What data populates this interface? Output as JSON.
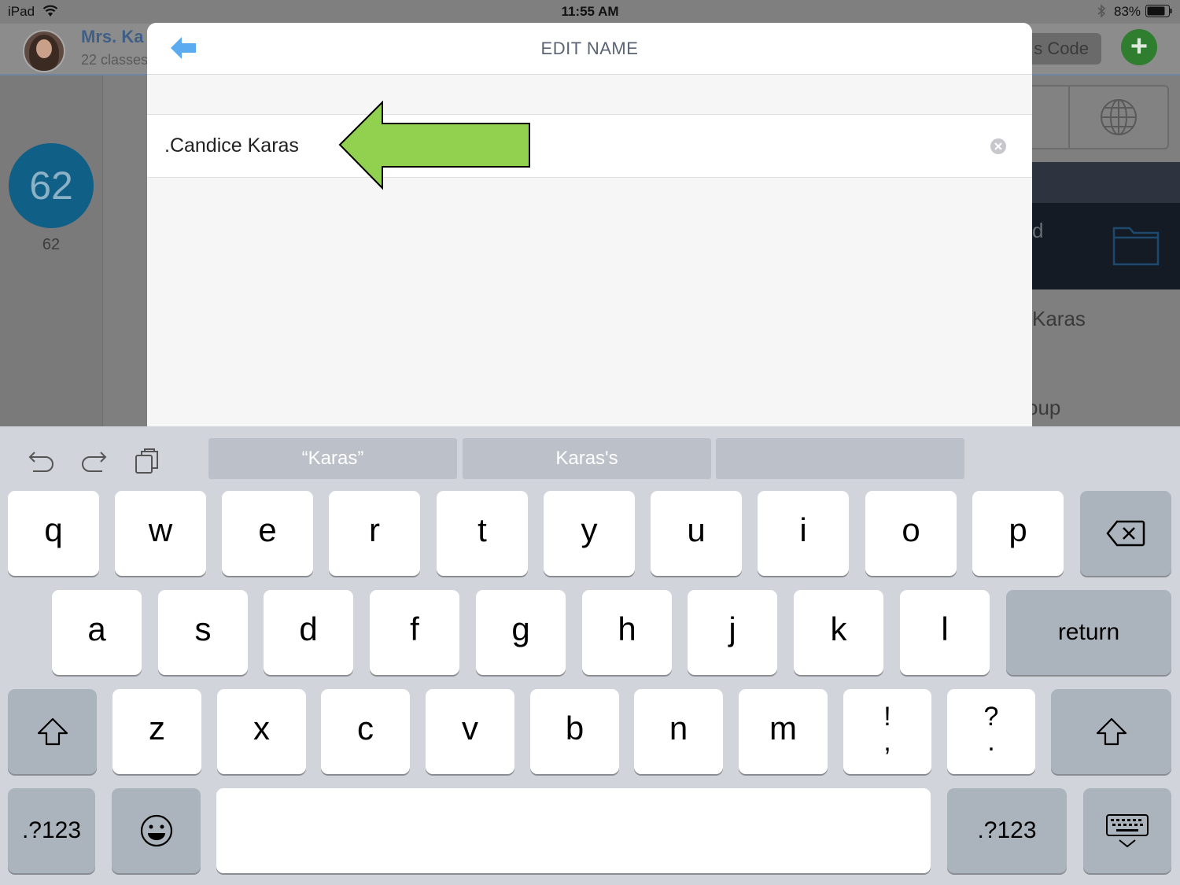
{
  "status_bar": {
    "device": "iPad",
    "time": "11:55 AM",
    "battery": "83%",
    "icons": [
      "wifi-icon",
      "bluetooth-icon",
      "battery-icon"
    ]
  },
  "background": {
    "teacher_name": "Mrs. Ka",
    "classes_count": "22 classes",
    "code_button": "s Code",
    "add_button": "+",
    "score_value": "62",
    "score_label": "62",
    "dark_row_text": "d",
    "name_row_text": "Karas",
    "group_row_text": "oup",
    "icons": [
      "globe-icon",
      "folder-icon",
      "add-icon"
    ]
  },
  "modal": {
    "title": "EDIT NAME",
    "name_value": ".Candice Karas",
    "icons": [
      "back-arrow-icon",
      "clear-icon",
      "green-arrow-annotation"
    ]
  },
  "keyboard": {
    "suggestions": [
      "“Karas”",
      "Karas's",
      ""
    ],
    "row1": [
      "q",
      "w",
      "e",
      "r",
      "t",
      "y",
      "u",
      "i",
      "o",
      "p"
    ],
    "row2": [
      "a",
      "s",
      "d",
      "f",
      "g",
      "h",
      "j",
      "k",
      "l"
    ],
    "row3": [
      "z",
      "x",
      "c",
      "v",
      "b",
      "n",
      "m"
    ],
    "punct1": {
      "top": "!",
      "bottom": ","
    },
    "punct2": {
      "top": "?",
      "bottom": "."
    },
    "return_label": "return",
    "numbers_label": ".?123",
    "space_label": "",
    "icons": [
      "undo-icon",
      "redo-icon",
      "clipboard-icon",
      "backspace-icon",
      "shift-icon",
      "emoji-icon",
      "keyboard-dismiss-icon"
    ]
  },
  "colors": {
    "accent_blue": "#5aabf0",
    "annotation_green": "#92d050",
    "keyboard_bg": "#d1d5db"
  }
}
